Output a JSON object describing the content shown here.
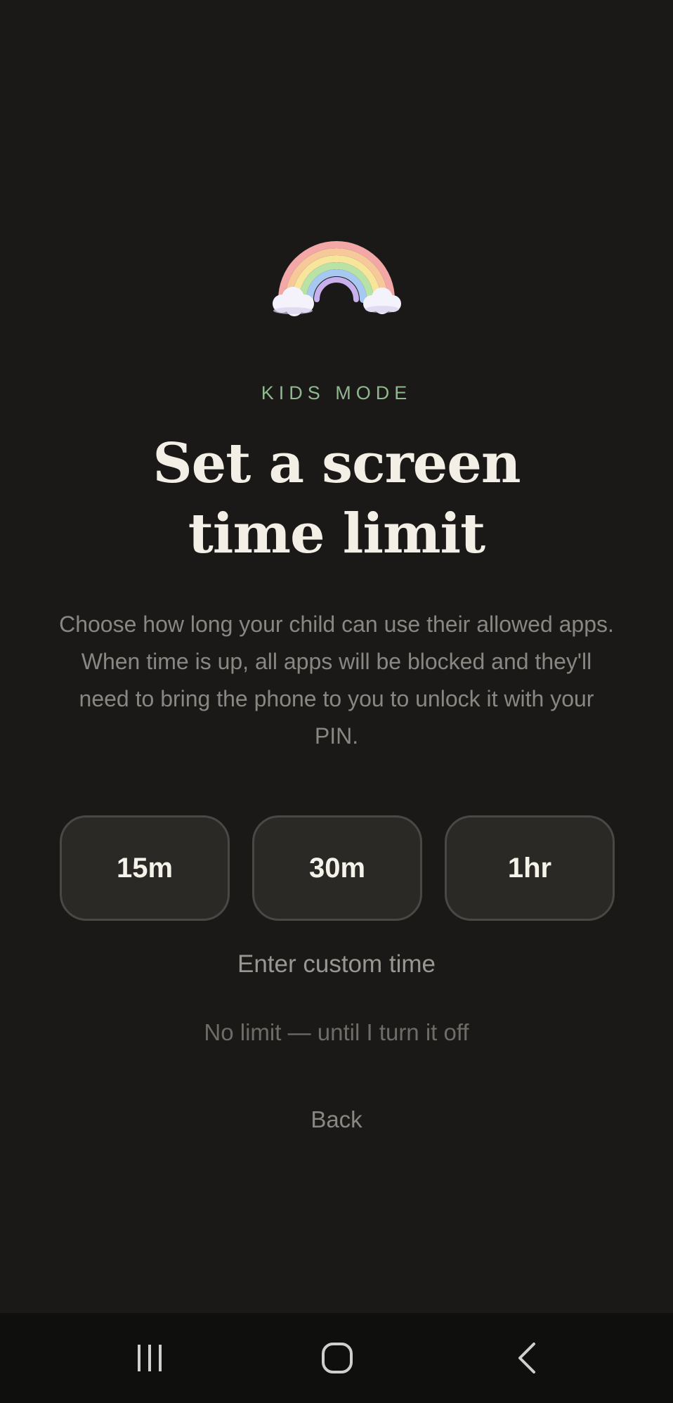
{
  "header": {
    "eyebrow": "KIDS MODE",
    "title_line1": "Set a screen",
    "title_line2": "time limit",
    "description": "Choose how long your child can use their allowed apps. When time is up, all apps will be blocked and they'll need to bring the phone to you to unlock it with your PIN."
  },
  "hero_icon": "rainbow-icon",
  "options": [
    {
      "label": "15m"
    },
    {
      "label": "30m"
    },
    {
      "label": "1hr"
    }
  ],
  "links": {
    "custom": "Enter custom time",
    "no_limit": "No limit — until I turn it off",
    "back": "Back"
  },
  "nav": {
    "recents_icon": "recents-icon",
    "home_icon": "home-icon",
    "back_icon": "back-arrow-icon"
  },
  "colors": {
    "background": "#1a1917",
    "accent": "#8fb88f",
    "title": "#f3efe6",
    "chip_bg": "#2a2926",
    "chip_border": "#4a4844"
  }
}
